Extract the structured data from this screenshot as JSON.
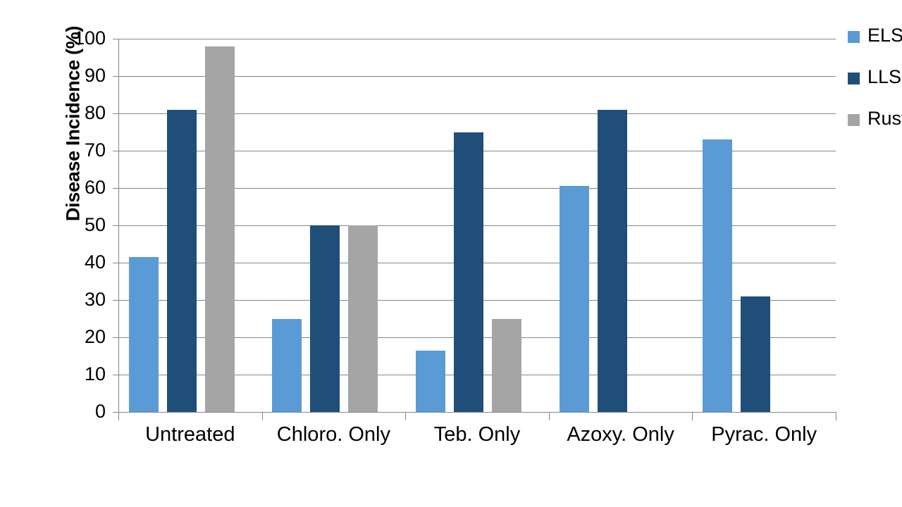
{
  "chart_data": {
    "type": "bar",
    "title": "",
    "xlabel": "",
    "ylabel": "Disease Incidence (%)",
    "ylim": [
      0,
      100
    ],
    "ytick_step": 10,
    "yticks": [
      100,
      90,
      80,
      70,
      60,
      50,
      40,
      30,
      20,
      10,
      0
    ],
    "grid": true,
    "legend_position": "right",
    "categories": [
      "Untreated",
      "Chloro. Only",
      "Teb. Only",
      "Azoxy. Only",
      "Pyrac. Only"
    ],
    "series": [
      {
        "name": "ELS",
        "color": "#5B9BD5",
        "values": [
          41.5,
          25,
          16.5,
          60.5,
          73
        ]
      },
      {
        "name": "LLS",
        "color": "#1F4E79",
        "values": [
          81,
          50,
          75,
          81,
          31
        ]
      },
      {
        "name": "Rust",
        "color": "#A5A5A5",
        "values": [
          98,
          50,
          25,
          null,
          null
        ]
      }
    ]
  },
  "legend": {
    "items": [
      {
        "label": "ELS",
        "color": "#5B9BD5"
      },
      {
        "label": "LLS",
        "color": "#1F4E79"
      },
      {
        "label": "Rust",
        "color": "#A5A5A5"
      }
    ]
  },
  "axes": {
    "y_title": "Disease Incidence (%)",
    "y_tick_labels": [
      "100",
      "90",
      "80",
      "70",
      "60",
      "50",
      "40",
      "30",
      "20",
      "10",
      "0"
    ],
    "x_tick_labels": [
      "Untreated",
      "Chloro. Only",
      "Teb. Only",
      "Azoxy. Only",
      "Pyrac. Only"
    ]
  },
  "colors": {
    "els": "#5B9BD5",
    "lls": "#1F4E79",
    "rust": "#A5A5A5",
    "axis": "#868686",
    "text": "#000000",
    "background": "#FFFFFF"
  }
}
